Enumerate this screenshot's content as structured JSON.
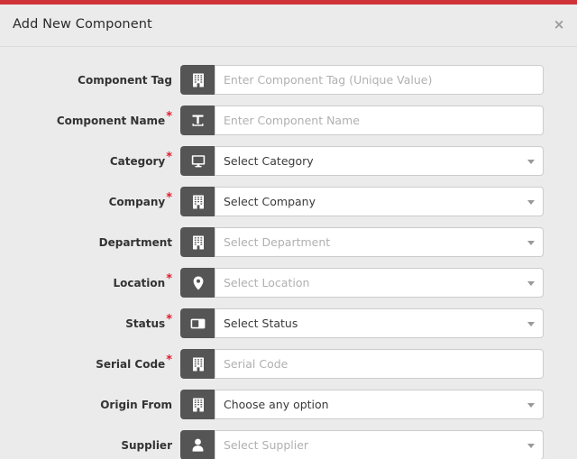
{
  "modal": {
    "title": "Add New Component",
    "close_label": "×",
    "accent_color": "#cf3339",
    "background_color": "#ebebeb",
    "addon_color": "#555555",
    "required_marker": "*",
    "required_marker_color": "#e8192c"
  },
  "fields": [
    {
      "label": "Component Tag",
      "required": false,
      "icon": "building-icon",
      "control": "text",
      "text": "Enter Component Tag (Unique Value)",
      "is_placeholder": true
    },
    {
      "label": "Component Name",
      "required": true,
      "icon": "text-format-icon",
      "control": "text",
      "text": "Enter Component Name",
      "is_placeholder": true
    },
    {
      "label": "Category",
      "required": true,
      "icon": "desktop-monitor-icon",
      "control": "select",
      "text": "Select Category",
      "is_placeholder": false
    },
    {
      "label": "Company",
      "required": true,
      "icon": "building-icon",
      "control": "select",
      "text": "Select Company",
      "is_placeholder": false
    },
    {
      "label": "Department",
      "required": false,
      "icon": "building-icon",
      "control": "select",
      "text": "Select Department",
      "is_placeholder": true
    },
    {
      "label": "Location",
      "required": true,
      "icon": "map-pin-icon",
      "control": "select",
      "text": "Select Location",
      "is_placeholder": true
    },
    {
      "label": "Status",
      "required": true,
      "icon": "toggle-switch-icon",
      "control": "select",
      "text": "Select Status",
      "is_placeholder": false
    },
    {
      "label": "Serial Code",
      "required": true,
      "icon": "building-icon",
      "control": "text",
      "text": "Serial Code",
      "is_placeholder": true
    },
    {
      "label": "Origin From",
      "required": false,
      "icon": "building-icon",
      "control": "select",
      "text": "Choose any option",
      "is_placeholder": false
    },
    {
      "label": "Supplier",
      "required": false,
      "icon": "user-icon",
      "control": "select",
      "text": "Select Supplier",
      "is_placeholder": true
    }
  ]
}
